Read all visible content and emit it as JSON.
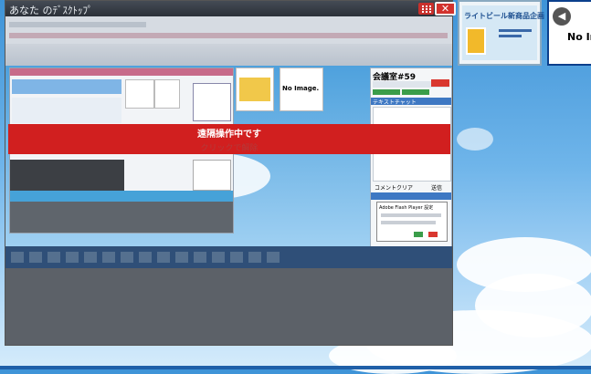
{
  "panel": {
    "title": "あなた のﾃﾞｽｸﾄｯﾌﾟ",
    "close_label": "✕"
  },
  "overlay": {
    "title": "遠隔操作中です",
    "subtitle": "クリックで解除"
  },
  "remote_screen": {
    "thumbnail_no_image": "No Image.",
    "conference_room": "会議室#59",
    "text_chat_header": "テキストチャット",
    "comment_clear": "コメントクリア",
    "send": "送信",
    "flash_dialog_title": "Adobe Flash Player 設定"
  },
  "right_thumbs": {
    "banner": "ライトビール新商品企画",
    "no_image": "No Im"
  }
}
